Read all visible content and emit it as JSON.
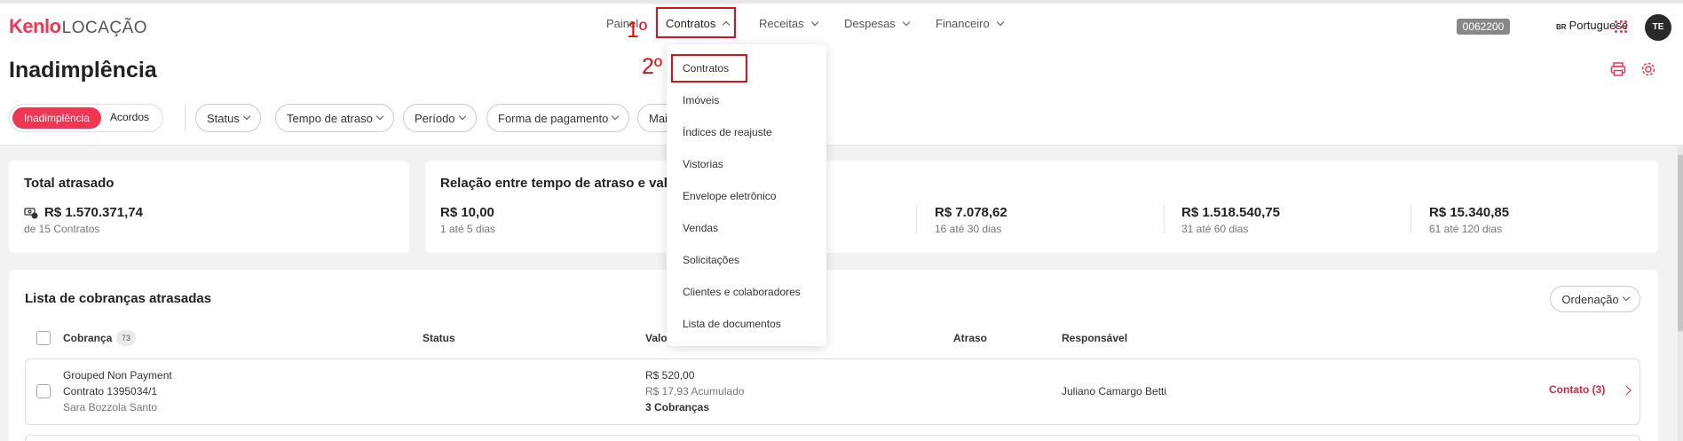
{
  "logo": {
    "brand": "Kenlo",
    "product": "LOCAÇÃO"
  },
  "nav": {
    "painel": "Painel",
    "contratos": "Contratos",
    "receitas": "Receitas",
    "despesas": "Despesas",
    "financeiro": "Financeiro"
  },
  "annotations": {
    "step1": "1º",
    "step2": "2º"
  },
  "account": {
    "code": "0062200",
    "lang_flag": "BR",
    "lang": "Portuguese",
    "avatar": "TE"
  },
  "page": {
    "title": "Inadimplência"
  },
  "toggle": {
    "active": "Inadimplência",
    "inactive": "Acordos"
  },
  "filters": [
    "Status",
    "Tempo de atraso",
    "Período",
    "Forma de pagamento",
    "Mai"
  ],
  "total_card": {
    "title": "Total atrasado",
    "value": "R$ 1.570.371,74",
    "sub": "de 15 Contratos"
  },
  "relation_card": {
    "title": "Relação entre tempo de atraso e valor",
    "items": [
      {
        "value": "R$ 10,00",
        "sub": "1 até 5 dias"
      },
      {
        "value": "R$ 7.078,62",
        "sub": "16 até 30 dias"
      },
      {
        "value": "R$ 1.518.540,75",
        "sub": "31 até 60 dias"
      },
      {
        "value": "R$ 15.340,85",
        "sub": "61 até 120 dias"
      }
    ]
  },
  "list": {
    "title": "Lista de cobranças atrasadas",
    "sort": "Ordenação",
    "count": "73",
    "columns": {
      "cobranca": "Cobrança",
      "status": "Status",
      "valor": "Valo",
      "atraso": "Atraso",
      "responsavel": "Responsável"
    },
    "rows": [
      {
        "name": "Grouped Non Payment",
        "contract": "Contrato 1395034/1",
        "person": "Sara Bozzola Santo",
        "value": "R$ 520,00",
        "accumulated": "R$ 17,93 Acumulado",
        "charges": "3 Cobranças",
        "responsible": "Juliano Camargo Betti",
        "contact": "Contato (3)"
      }
    ]
  },
  "dropdown": {
    "items": [
      "Contratos",
      "Imóveis",
      "Índices de reajuste",
      "Vistorias",
      "Envelope eletrônico",
      "Vendas",
      "Solicitações",
      "Clientes e colaboradores",
      "Lista de documentos"
    ]
  }
}
